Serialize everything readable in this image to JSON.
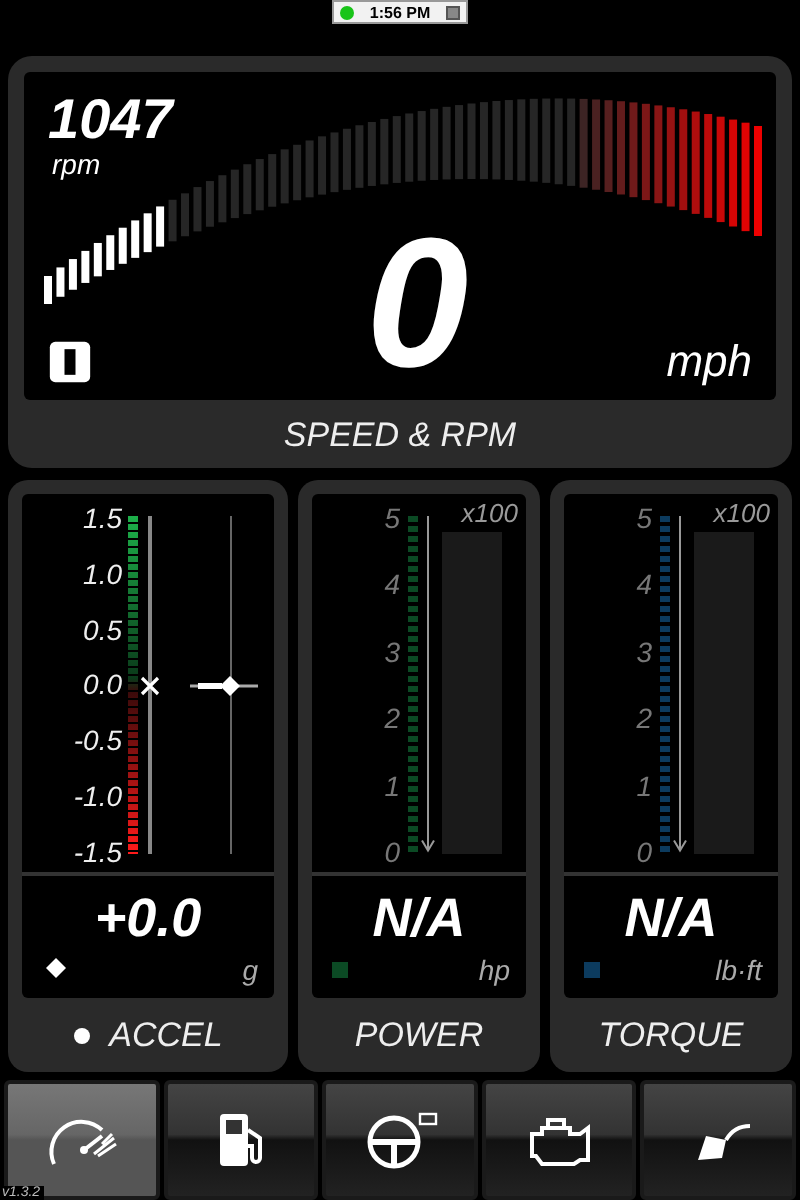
{
  "status": {
    "time": "1:56 PM",
    "connected": true
  },
  "speed": {
    "rpm": "1047",
    "rpm_unit": "rpm",
    "speed": "0",
    "unit": "mph",
    "title": "SPEED & RPM"
  },
  "gauges": [
    {
      "kind": "accel",
      "ticks": [
        "1.5",
        "1.0",
        "0.5",
        "0.0",
        "-0.5",
        "-1.0",
        "-1.5"
      ],
      "value": "+0.0",
      "unit": "g",
      "label": "ACCEL"
    },
    {
      "kind": "bar",
      "ticks": [
        "5",
        "4",
        "3",
        "2",
        "1",
        "0"
      ],
      "multiplier": "x100",
      "value": "N/A",
      "unit": "hp",
      "color": "#0b4a24",
      "label": "POWER"
    },
    {
      "kind": "bar",
      "ticks": [
        "5",
        "4",
        "3",
        "2",
        "1",
        "0"
      ],
      "multiplier": "x100",
      "value": "N/A",
      "unit": "lb·ft",
      "color": "#0c3b5e",
      "label": "TORQUE"
    }
  ],
  "tabs": [
    {
      "selected": true
    },
    {
      "selected": false
    },
    {
      "selected": false
    },
    {
      "selected": false
    },
    {
      "selected": false
    }
  ],
  "version": "v1.3.2"
}
